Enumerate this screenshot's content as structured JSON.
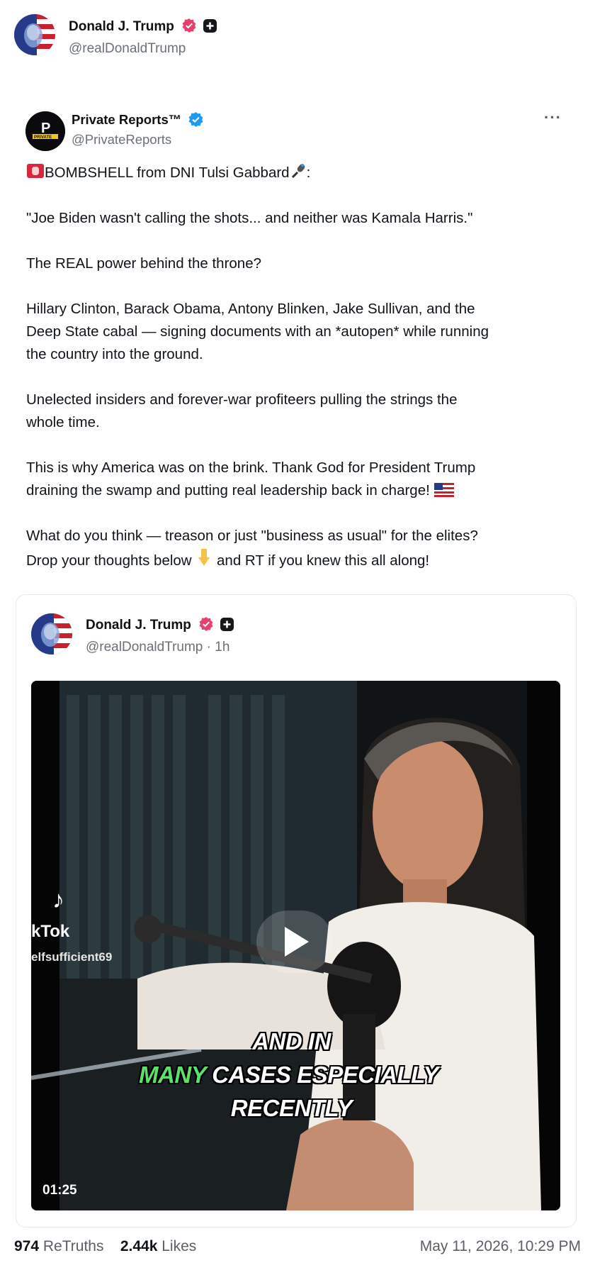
{
  "reposter": {
    "name": "Donald J. Trump",
    "handle": "@realDonaldTrump"
  },
  "post": {
    "author_name": "Private Reports™",
    "author_handle": "@PrivateReports",
    "avatar_text_top": "P",
    "avatar_text_bottom": "PRIVATE",
    "more_label": "···",
    "headline": "BOMBSHELL from DNI Tulsi Gabbard",
    "headline_suffix": ":",
    "paragraphs": [
      "\"Joe Biden wasn't calling the shots... and neither was Kamala Harris.\"",
      "The REAL power behind the throne?",
      "Hillary Clinton, Barack Obama, Antony Blinken, Jake Sullivan, and the\nDeep State cabal — signing documents with an *autopen* while running\nthe country into the ground.",
      "Unelected insiders and forever-war profiteers pulling the strings the\nwhole time."
    ],
    "para5": "This is why America was on the brink. Thank God for President Trump\ndraining the swamp and putting real leadership back in charge!",
    "para6_line1": "What do you think — treason or just \"business as usual\" for the elites?",
    "para6_line2a": "Drop your thoughts below",
    "para6_line2b": "and RT if you knew this all along!"
  },
  "quoted": {
    "name": "Donald J. Trump",
    "handle": "@realDonaldTrump",
    "time": "· 1h",
    "video": {
      "duration": "01:25",
      "caption_line1": "AND IN",
      "caption_line2_green": "MANY",
      "caption_line2_rest": " CASES ESPECIALLY",
      "caption_line3": "RECENTLY",
      "watermark_brand": "kTok",
      "watermark_user": "elfsufficient69"
    }
  },
  "footer": {
    "retruths_count": "974",
    "retruths_label": "ReTruths",
    "likes_count": "2.44k",
    "likes_label": "Likes",
    "timestamp": "May 11, 2026, 10:29 PM"
  },
  "colors": {
    "verified_pink": "#e5416d",
    "verified_blue": "#1d9bf0",
    "caption_green": "#5fe06a"
  },
  "icons": [
    "flag-avatar",
    "verified-badge-icon",
    "plus-badge-icon",
    "more-icon",
    "siren-emoji",
    "microphone-emoji",
    "us-flag-emoji",
    "point-down-emoji",
    "play-icon"
  ]
}
